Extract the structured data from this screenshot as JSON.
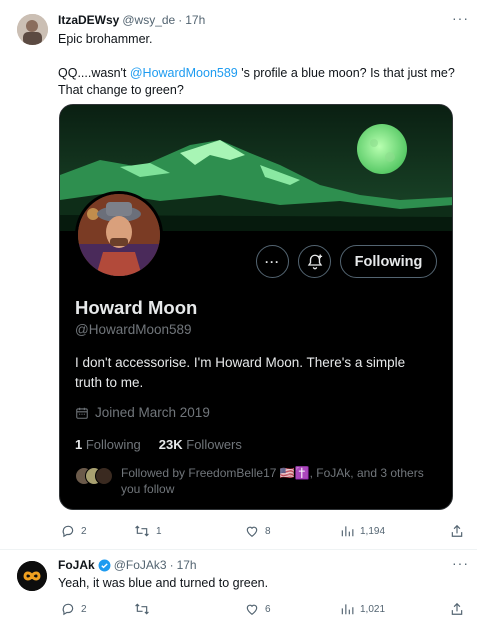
{
  "tweet1": {
    "display_name": "ItzaDEWsy",
    "handle": "@wsy_de",
    "sep": "·",
    "time": "17h",
    "more": "···",
    "line1": "Epic brohammer.",
    "line2_pre": "QQ....wasn't ",
    "line2_mention": "@HowardMoon589",
    "line2_post": " 's profile a blue moon?  Is that just me?",
    "line3": "That change to green?",
    "actions": {
      "replies": "2",
      "retweets": "1",
      "likes": "8",
      "views": "1,194"
    }
  },
  "profile_card": {
    "name": "Howard Moon",
    "handle": "@HowardMoon589",
    "bio": "I don't accessorise. I'm Howard Moon. There's a simple truth to me.",
    "joined": "Joined March 2019",
    "following_count": "1",
    "following_label": "Following",
    "followers_count": "23K",
    "followers_label": "Followers",
    "followed_by": "Followed by FreedomBelle17 🇺🇸✝️, FoJAk, and 3 others you follow",
    "follow_button": "Following",
    "more_button": "···"
  },
  "tweet2": {
    "display_name": "FoJAk",
    "handle": "@FoJAk3",
    "sep": "·",
    "time": "17h",
    "more": "···",
    "text": "Yeah, it was blue and turned to green.",
    "actions": {
      "replies": "2",
      "retweets": "",
      "likes": "6",
      "views": "1,021"
    }
  },
  "colors": {
    "accent": "#1d9bf0",
    "banner_green": "#2ecc71",
    "moon": "#7be38f",
    "card_bg": "#000000"
  }
}
